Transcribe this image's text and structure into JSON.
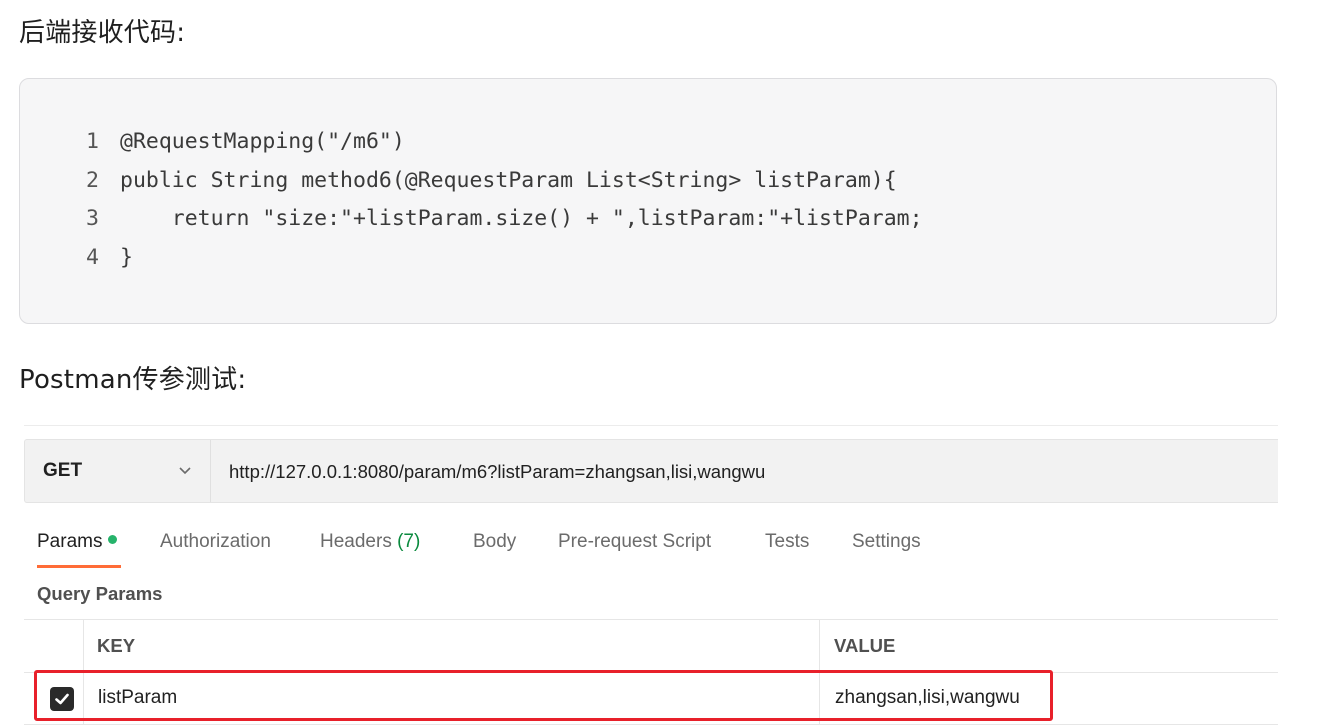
{
  "article": {
    "heading_backend": "后端接收代码:",
    "heading_postman": "Postman传参测试:"
  },
  "code": {
    "lines": [
      {
        "num": "1",
        "text": "@RequestMapping(\"/m6\")"
      },
      {
        "num": "2",
        "text": "public String method6(@RequestParam List<String> listParam){"
      },
      {
        "num": "3",
        "text": "    return \"size:\"+listParam.size() + \",listParam:\"+listParam;"
      },
      {
        "num": "4",
        "text": "}"
      }
    ]
  },
  "postman": {
    "method": "GET",
    "url": "http://127.0.0.1:8080/param/m6?listParam=zhangsan,lisi,wangwu",
    "tabs": {
      "params": "Params",
      "authorization": "Authorization",
      "headers": "Headers",
      "headers_count": "(7)",
      "body": "Body",
      "pre_request_script": "Pre-request Script",
      "tests": "Tests",
      "settings": "Settings"
    },
    "query_params_title": "Query Params",
    "table": {
      "key_header": "KEY",
      "value_header": "VALUE",
      "rows": [
        {
          "checked": true,
          "key": "listParam",
          "value": "zhangsan,lisi,wangwu"
        }
      ]
    },
    "colors": {
      "accent_orange": "#ff6c37",
      "dot_green": "#26b36b",
      "count_green": "#0a8a3e",
      "highlight_red": "#e8202a"
    }
  }
}
